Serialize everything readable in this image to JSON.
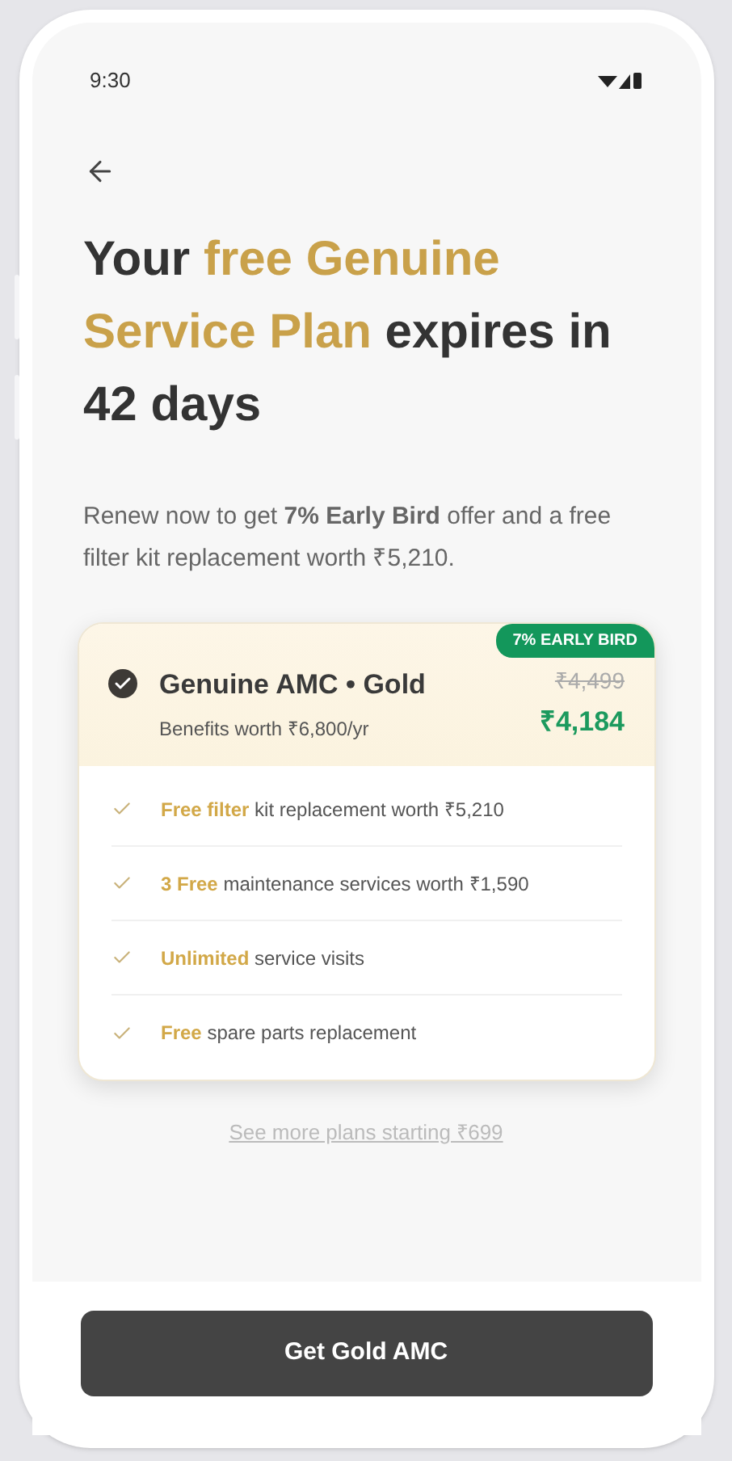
{
  "status_bar": {
    "time": "9:30"
  },
  "title_parts": [
    {
      "text": "Your ",
      "highlight": false
    },
    {
      "text": "free Genuine Service Plan",
      "highlight": true
    },
    {
      "text": " expires in 42 days",
      "highlight": false
    }
  ],
  "description": "Renew now to get **7% Early Bird** offer and a free filter kit replacement worth ₹5,210.",
  "plan": {
    "badge": "7% EARLY BIRD",
    "selected": true,
    "name": "Genuine AMC • Gold",
    "subtitle": "Benefits worth ₹6,800/yr",
    "old_price": "₹4,499",
    "price": "₹4,184",
    "benefits": [
      {
        "highlight": "Free filter",
        "text": " kit replacement worth ₹5,210"
      },
      {
        "highlight": "3 Free",
        "text": " maintenance services worth ₹1,590"
      },
      {
        "highlight": "Unlimited",
        "text": " service visits"
      },
      {
        "highlight": "Free",
        "text": " spare parts replacement"
      }
    ]
  },
  "more_link": "See more plans starting ₹699",
  "cta": "Get Gold AMC"
}
